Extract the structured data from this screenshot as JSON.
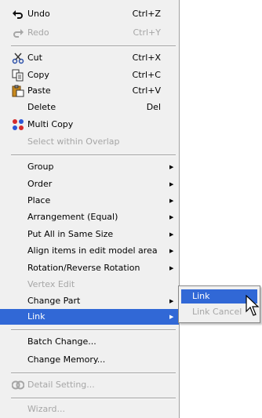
{
  "menu": {
    "undo": {
      "label": "Undo",
      "shortcut": "Ctrl+Z"
    },
    "redo": {
      "label": "Redo",
      "shortcut": "Ctrl+Y"
    },
    "cut": {
      "label": "Cut",
      "shortcut": "Ctrl+X"
    },
    "copy": {
      "label": "Copy",
      "shortcut": "Ctrl+C"
    },
    "paste": {
      "label": "Paste",
      "shortcut": "Ctrl+V"
    },
    "delete": {
      "label": "Delete",
      "shortcut": "Del"
    },
    "multi_copy": {
      "label": "Multi Copy"
    },
    "select_within_overlap": {
      "label": "Select within Overlap"
    },
    "group": {
      "label": "Group"
    },
    "order": {
      "label": "Order"
    },
    "place": {
      "label": "Place"
    },
    "arrangement": {
      "label": "Arrangement (Equal)"
    },
    "same_size": {
      "label": "Put All in Same Size"
    },
    "align_items": {
      "label": "Align items in edit model area"
    },
    "rotation": {
      "label": "Rotation/Reverse Rotation"
    },
    "vertex_edit": {
      "label": "Vertex Edit"
    },
    "change_part": {
      "label": "Change Part"
    },
    "link": {
      "label": "Link"
    },
    "batch_change": {
      "label": "Batch Change..."
    },
    "change_memory": {
      "label": "Change Memory..."
    },
    "detail_setting": {
      "label": "Detail Setting..."
    },
    "wizard": {
      "label": "Wizard..."
    }
  },
  "submenu": {
    "link": {
      "label": "Link"
    },
    "link_cancel": {
      "label": "Link Cancel"
    }
  },
  "colors": {
    "highlight": "#3168d6",
    "menu_bg": "#f0f0f0",
    "disabled": "#a6a6a6"
  },
  "icons": [
    "undo-icon",
    "redo-icon",
    "scissors-icon",
    "copy-icon",
    "paste-icon",
    "multi-copy-icon",
    "detail-setting-icon",
    "submenu-arrow-icon",
    "mouse-cursor-icon"
  ]
}
